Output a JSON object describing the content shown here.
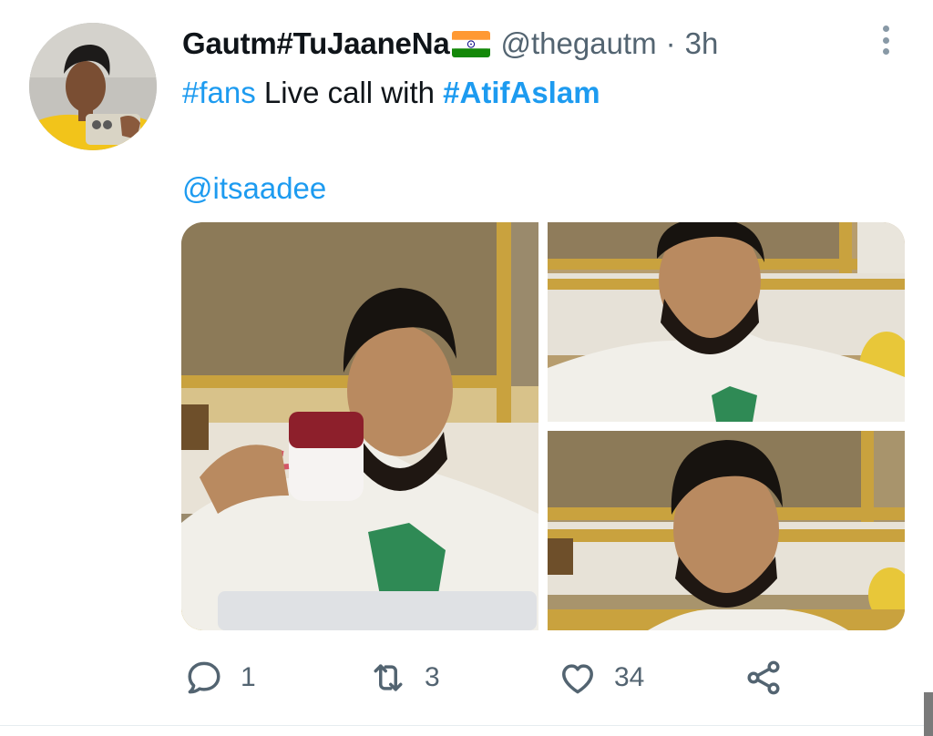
{
  "tweet": {
    "author": {
      "display_name": "Gautm#TuJaaneNa",
      "flag_icon": "india-flag-icon",
      "handle": "@thegautm",
      "separator": "·",
      "time": "3h"
    },
    "text": {
      "hashtag_1": "#fans",
      "middle": " Live call with ",
      "hashtag_2": "#AtifAslam",
      "mention": "@itsaadee"
    },
    "media": [
      {
        "icon": "photo-drinking-from-mug"
      },
      {
        "icon": "photo-looking-down"
      },
      {
        "icon": "photo-looking-up"
      }
    ],
    "actions": {
      "reply_count": "1",
      "retweet_count": "3",
      "like_count": "34"
    }
  },
  "colors": {
    "link": "#1d9bf0",
    "secondary": "#536471",
    "text": "#0f1419"
  }
}
